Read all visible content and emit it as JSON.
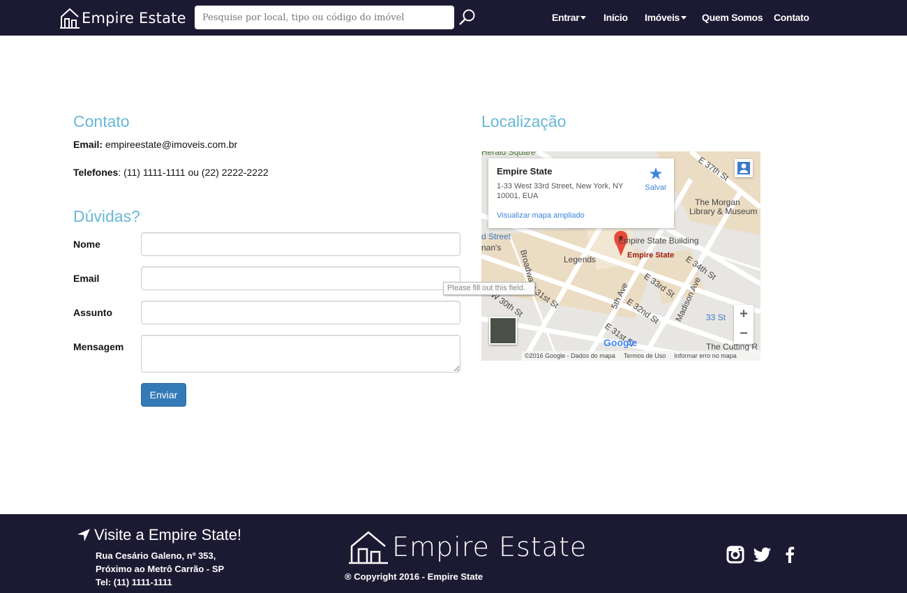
{
  "navbar": {
    "brand": "Empire Estate",
    "search_placeholder": "Pesquise por local, tipo ou código do imóvel",
    "items": [
      "Entrar",
      "Início",
      "Imóveis",
      "Quem Somos",
      "Contato"
    ]
  },
  "contact": {
    "heading": "Contato",
    "email_label": "Email:",
    "email_value": "empireestate@imoveis.com.br",
    "phones_label": "Telefones",
    "phones_value": ": (11) 1111-1111 ou (22) 2222-2222"
  },
  "form": {
    "heading": "Dúvidas?",
    "labels": {
      "nome": "Nome",
      "email": "Email",
      "assunto": "Assunto",
      "mensagem": "Mensagem"
    },
    "submit": "Enviar",
    "validation_tooltip": "Please fill out this field."
  },
  "location": {
    "heading": "Localização",
    "card": {
      "title": "Empire State",
      "address": "1-33 West 33rd Street, New York, NY 10001, EUA",
      "save": "Salvar",
      "link": "Visualizar mapa ampliado"
    },
    "map_labels": {
      "herald": "Herald Square",
      "e37": "E 37th St",
      "morgan": "The Morgan",
      "morgan2": "Library & Museum",
      "dstreet": "d Street",
      "mans": "nan's",
      "esb": "Empire State Building",
      "pin": "Empire State",
      "legends": "Legends",
      "e34": "E 34th St",
      "broadway": "Broadway",
      "w31": "W 31st St",
      "w30": "W 30th St",
      "e33": "E 33rd St",
      "fifth": "5th Ave",
      "e32": "E 32nd St",
      "madison": "Madison Ave",
      "st33": "33 St",
      "e31": "E 31st St",
      "cutting": "The Cutting R",
      "google": "Google"
    },
    "footer_items": [
      "©2016 Google - Dados do mapa",
      "Termos de Uso",
      "Informar erro no mapa"
    ],
    "zoom_in": "+",
    "zoom_out": "−"
  },
  "footer": {
    "visit_title": "Visite a Empire State!",
    "address_lines": [
      "Rua Cesário Galeno, nº 353,",
      "Próximo ao Metrô Carrão - SP",
      "Tel: (11) 1111-1111"
    ],
    "brand": "Empire Estate",
    "copyright": "® Copyright 2016 - Empire State"
  },
  "colors": {
    "navbar_bg": "#1c1a33",
    "heading": "#69b7d5",
    "button": "#337ab7"
  }
}
